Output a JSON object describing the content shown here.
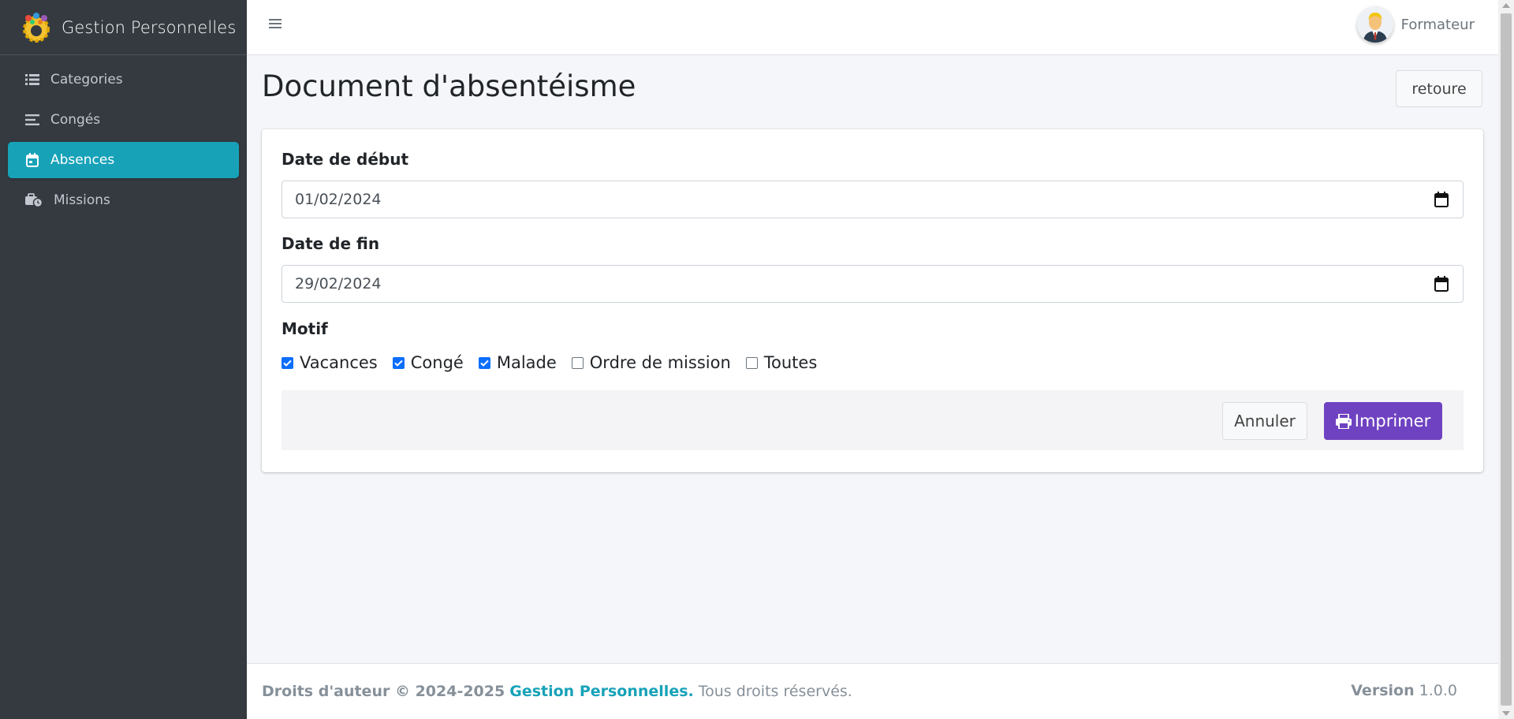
{
  "sidebar": {
    "brand": "Gestion Personnelles",
    "items": [
      {
        "label": "Categories",
        "icon": "list-icon"
      },
      {
        "label": "Congés",
        "icon": "bars-icon"
      },
      {
        "label": "Absences",
        "icon": "calendar-icon",
        "active": true
      },
      {
        "label": "Missions",
        "icon": "suitcase-clock-icon"
      }
    ]
  },
  "topbar": {
    "user_name": "Formateur"
  },
  "main": {
    "title": "Document d'absentéisme",
    "back_label": "retoure"
  },
  "form": {
    "start_label": "Date de début",
    "start_value": "01/02/2024",
    "end_label": "Date de fin",
    "end_value": "29/02/2024",
    "motif_label": "Motif",
    "motifs": [
      {
        "label": "Vacances",
        "checked": true
      },
      {
        "label": "Congé",
        "checked": true
      },
      {
        "label": "Malade",
        "checked": true
      },
      {
        "label": "Ordre de mission",
        "checked": false
      },
      {
        "label": "Toutes",
        "checked": false
      }
    ],
    "cancel_label": "Annuler",
    "print_label": "Imprimer"
  },
  "footer": {
    "copyright": "Droits d'auteur © 2024-2025",
    "brand": "Gestion Personnelles.",
    "rights": "Tous droits réservés.",
    "version_label": "Version",
    "version_value": "1.0.0"
  },
  "colors": {
    "sidebar_bg": "#343a40",
    "active_bg": "#17a2b8",
    "print_btn": "#6f42c1",
    "checkbox": "#0b6efd"
  }
}
